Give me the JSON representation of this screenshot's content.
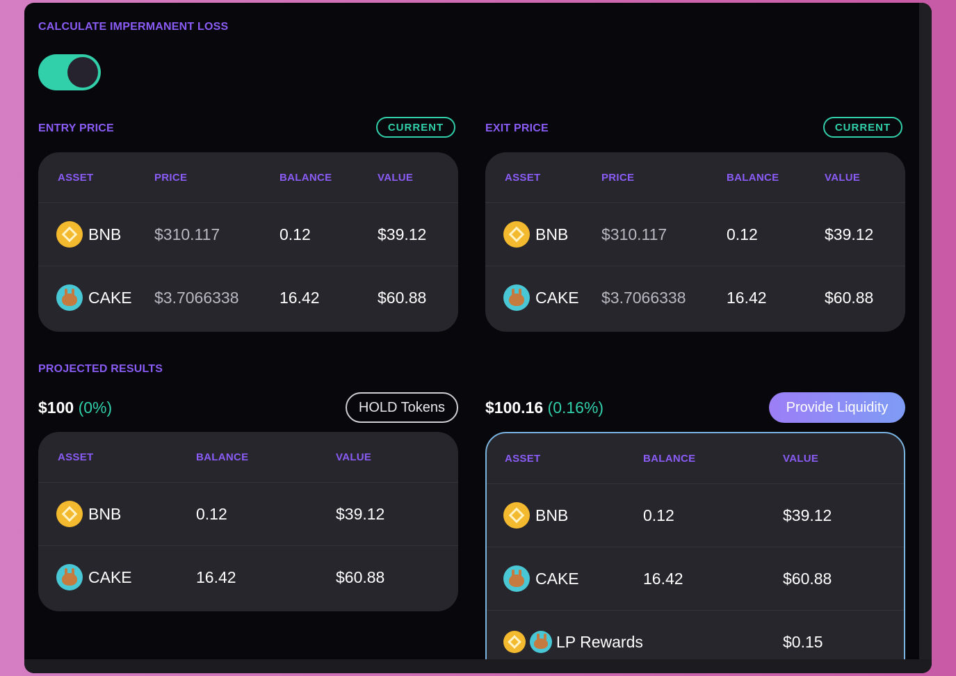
{
  "calculator": {
    "title": "CALCULATE IMPERMANENT LOSS",
    "toggle_on": true
  },
  "entry": {
    "title": "ENTRY PRICE",
    "current_label": "CURRENT",
    "headers": [
      "ASSET",
      "PRICE",
      "BALANCE",
      "VALUE"
    ],
    "rows": [
      {
        "asset": "BNB",
        "icon": "bnb-icon",
        "price": "$310.117",
        "balance": "0.12",
        "value": "$39.12"
      },
      {
        "asset": "CAKE",
        "icon": "cake-icon",
        "price": "$3.7066338",
        "balance": "16.42",
        "value": "$60.88"
      }
    ]
  },
  "exit": {
    "title": "EXIT PRICE",
    "current_label": "CURRENT",
    "headers": [
      "ASSET",
      "PRICE",
      "BALANCE",
      "VALUE"
    ],
    "rows": [
      {
        "asset": "BNB",
        "icon": "bnb-icon",
        "price": "$310.117",
        "balance": "0.12",
        "value": "$39.12"
      },
      {
        "asset": "CAKE",
        "icon": "cake-icon",
        "price": "$3.7066338",
        "balance": "16.42",
        "value": "$60.88"
      }
    ]
  },
  "projected": {
    "title": "PROJECTED RESULTS",
    "hold": {
      "total": "$100",
      "pct": "(0%)",
      "button": "HOLD Tokens",
      "headers": [
        "ASSET",
        "BALANCE",
        "VALUE"
      ],
      "rows": [
        {
          "asset": "BNB",
          "icon": "bnb-icon",
          "balance": "0.12",
          "value": "$39.12"
        },
        {
          "asset": "CAKE",
          "icon": "cake-icon",
          "balance": "16.42",
          "value": "$60.88"
        }
      ]
    },
    "liquidity": {
      "total": "$100.16",
      "pct": "(0.16%)",
      "button": "Provide Liquidity",
      "headers": [
        "ASSET",
        "BALANCE",
        "VALUE"
      ],
      "rows": [
        {
          "asset": "BNB",
          "icon": "bnb-icon",
          "balance": "0.12",
          "value": "$39.12"
        },
        {
          "asset": "CAKE",
          "icon": "cake-icon",
          "balance": "16.42",
          "value": "$60.88"
        }
      ],
      "rewards": {
        "label": "LP Rewards",
        "value": "$0.15"
      }
    }
  },
  "colors": {
    "accent_purple": "#8a5cf6",
    "accent_teal": "#31d0aa",
    "card_bg": "#27262d",
    "panel_bg": "#08070c"
  }
}
